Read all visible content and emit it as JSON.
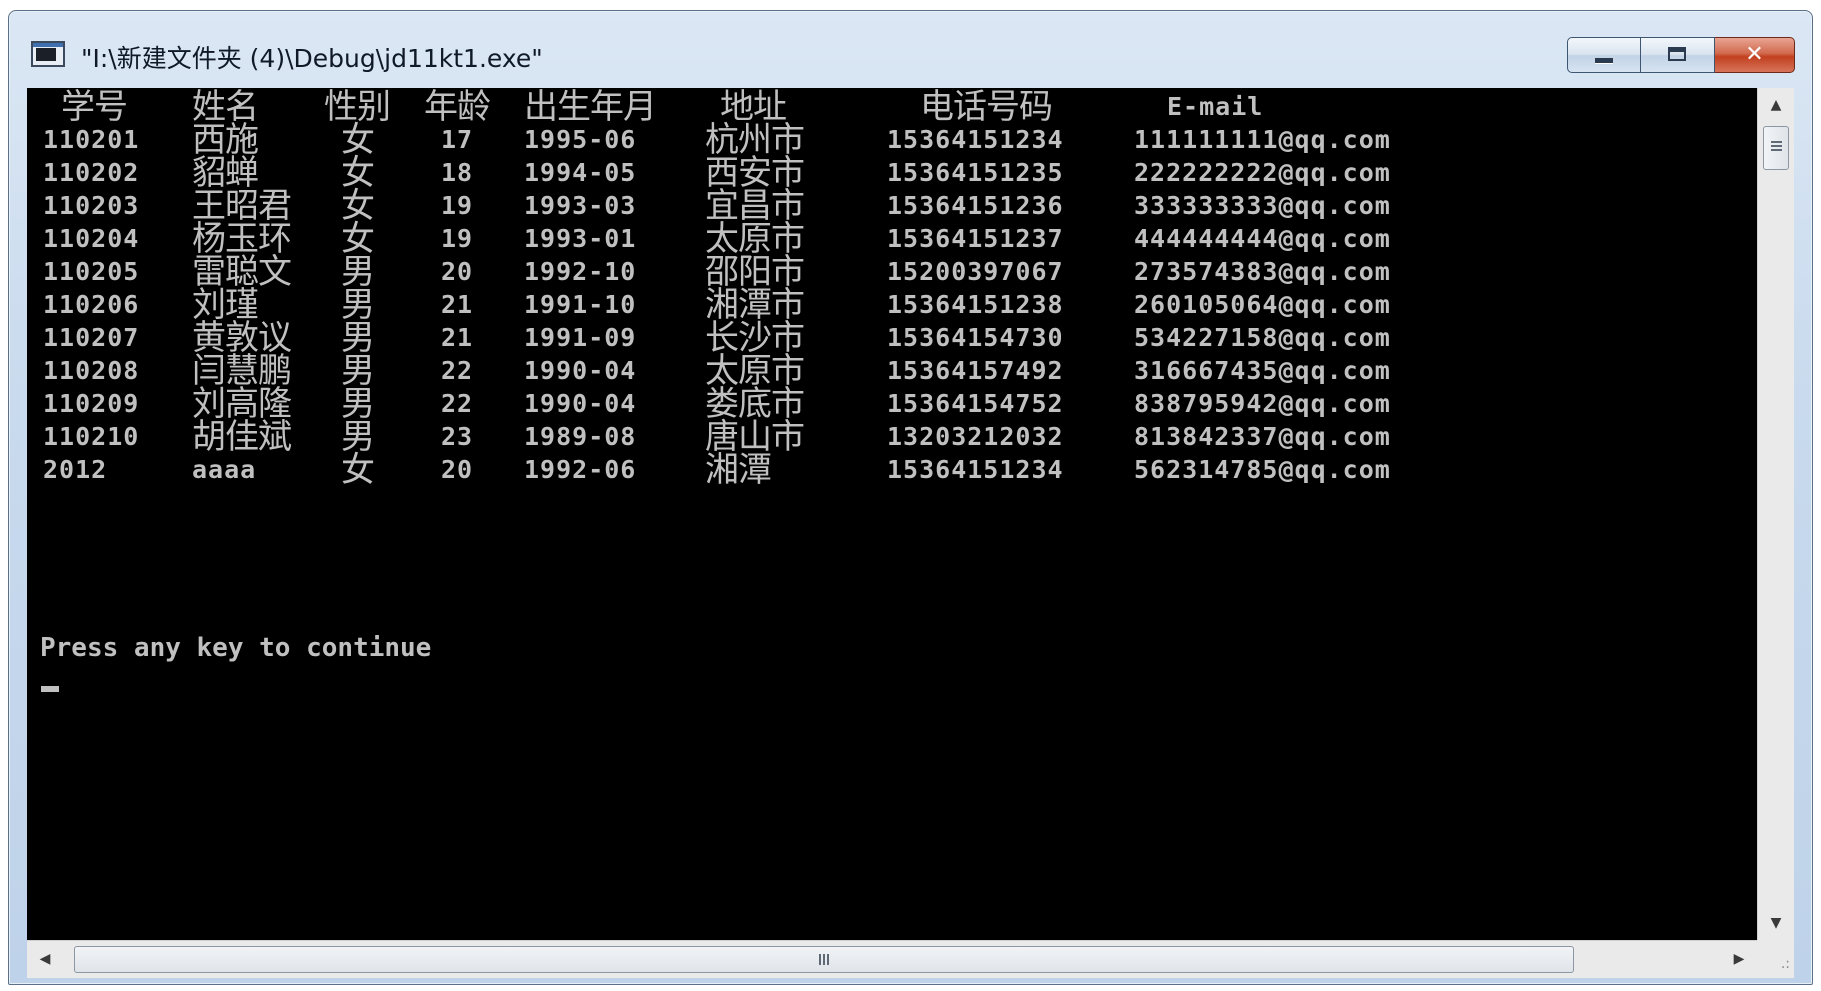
{
  "window": {
    "title": "\"I:\\新建文件夹 (4)\\Debug\\jd11kt1.exe\"",
    "icon": "console-app-icon",
    "buttons": {
      "minimize": "minimize-icon",
      "maximize": "maximize-icon",
      "close": "✕"
    }
  },
  "console": {
    "headers": {
      "id": "学号",
      "name": "姓名",
      "sex": "性别",
      "age": "年龄",
      "birth": "出生年月",
      "address": "地址",
      "phone": "电话号码",
      "email": "E-mail"
    },
    "rows": [
      {
        "id": "110201",
        "name": "西施",
        "sex": "女",
        "age": "17",
        "birth": "1995-06",
        "address": "杭州市",
        "phone": "15364151234",
        "email": "111111111@qq.com"
      },
      {
        "id": "110202",
        "name": "貂蝉",
        "sex": "女",
        "age": "18",
        "birth": "1994-05",
        "address": "西安市",
        "phone": "15364151235",
        "email": "222222222@qq.com"
      },
      {
        "id": "110203",
        "name": "王昭君",
        "sex": "女",
        "age": "19",
        "birth": "1993-03",
        "address": "宜昌市",
        "phone": "15364151236",
        "email": "333333333@qq.com"
      },
      {
        "id": "110204",
        "name": "杨玉环",
        "sex": "女",
        "age": "19",
        "birth": "1993-01",
        "address": "太原市",
        "phone": "15364151237",
        "email": "444444444@qq.com"
      },
      {
        "id": "110205",
        "name": "雷聪文",
        "sex": "男",
        "age": "20",
        "birth": "1992-10",
        "address": "邵阳市",
        "phone": "15200397067",
        "email": "273574383@qq.com"
      },
      {
        "id": "110206",
        "name": "刘瑾",
        "sex": "男",
        "age": "21",
        "birth": "1991-10",
        "address": "湘潭市",
        "phone": "15364151238",
        "email": "260105064@qq.com"
      },
      {
        "id": "110207",
        "name": "黄敦议",
        "sex": "男",
        "age": "21",
        "birth": "1991-09",
        "address": "长沙市",
        "phone": "15364154730",
        "email": "534227158@qq.com"
      },
      {
        "id": "110208",
        "name": "闫慧鹏",
        "sex": "男",
        "age": "22",
        "birth": "1990-04",
        "address": "太原市",
        "phone": "15364157492",
        "email": "316667435@qq.com"
      },
      {
        "id": "110209",
        "name": "刘高隆",
        "sex": "男",
        "age": "22",
        "birth": "1990-04",
        "address": "娄底市",
        "phone": "15364154752",
        "email": "838795942@qq.com"
      },
      {
        "id": "110210",
        "name": "胡佳斌",
        "sex": "男",
        "age": "23",
        "birth": "1989-08",
        "address": "唐山市",
        "phone": "13203212032",
        "email": "813842337@qq.com"
      },
      {
        "id": "2012",
        "name": "aaaa",
        "sex": "女",
        "age": "20",
        "birth": "1992-06",
        "address": "湘潭",
        "phone": "15364151234",
        "email": "562314785@qq.com"
      }
    ],
    "prompt": "Press any key to continue"
  },
  "scrollbars": {
    "up": "▲",
    "down": "▼",
    "left": "◀",
    "right": "▶",
    "size_grip": ".:"
  },
  "colors": {
    "console_bg": "#000000",
    "console_text": "#c0c0c0",
    "close_button": "#c2401f",
    "frame": "#c9daee"
  }
}
